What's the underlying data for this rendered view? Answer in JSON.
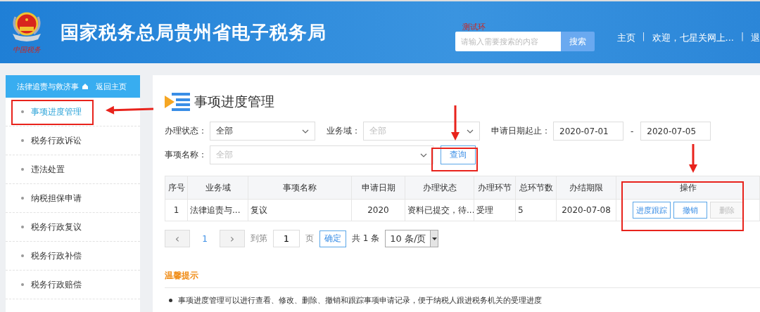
{
  "header": {
    "emblem_caption": "中国税务",
    "title": "国家税务总局贵州省电子税务局",
    "env_label": "测试环",
    "search": {
      "placeholder": "请输入需要搜索的内容",
      "button": "搜索"
    },
    "nav": [
      {
        "kind": "link",
        "text": "主页"
      },
      {
        "kind": "sep",
        "text": "|"
      },
      {
        "kind": "link",
        "text": "欢迎，七星关网上..."
      },
      {
        "kind": "sep",
        "text": "|"
      },
      {
        "kind": "link",
        "text": "退"
      }
    ]
  },
  "sidebar": {
    "title": "法律追责与救济事",
    "back": "返回主页",
    "items": [
      {
        "label": "事项进度管理",
        "selected": true
      },
      {
        "label": "税务行政诉讼",
        "selected": false
      },
      {
        "label": "违法处置",
        "selected": false
      },
      {
        "label": "纳税担保申请",
        "selected": false
      },
      {
        "label": "税务行政复议",
        "selected": false
      },
      {
        "label": "税务行政补偿",
        "selected": false
      },
      {
        "label": "税务行政赔偿",
        "selected": false
      }
    ]
  },
  "page_title": "事项进度管理",
  "filters": {
    "status": {
      "label": "办理状态：",
      "value": "全部"
    },
    "domain": {
      "label": "业务域：",
      "placeholder": "全部"
    },
    "date": {
      "label": "申请日期起止：",
      "from": "2020-07-01",
      "sep": "-",
      "to": "2020-07-05"
    },
    "item": {
      "label": "事项名称：",
      "placeholder": "全部"
    },
    "query": "查询"
  },
  "table": {
    "columns": [
      "序号",
      "业务域",
      "事项名称",
      "申请日期",
      "办理状态",
      "办理环节",
      "总环节数",
      "办结期限",
      "操作"
    ],
    "rows": [
      {
        "cells": [
          "1",
          "法律追责与...",
          "复议",
          "2020",
          "资料已提交，待...",
          "受理",
          "5",
          "2020-07-08"
        ],
        "actions": [
          {
            "label": "进度跟踪",
            "disabled": false
          },
          {
            "label": "撤销",
            "disabled": false
          },
          {
            "label": "删除",
            "disabled": true
          }
        ]
      }
    ]
  },
  "pagination": {
    "prev": "‹",
    "pages": [
      {
        "label": "1",
        "selected": true
      }
    ],
    "next": "›",
    "goto": "到第",
    "page_value": "1",
    "page_unit": "页",
    "confirm": "确定",
    "total": "共 1 条",
    "page_size": "10 条/页"
  },
  "tips": {
    "title": "温馨提示",
    "items": [
      "事项进度管理可以进行查看、修改、删除、撤销和跟踪事项申请记录，便于纳税人跟进税务机关的受理进度"
    ]
  }
}
